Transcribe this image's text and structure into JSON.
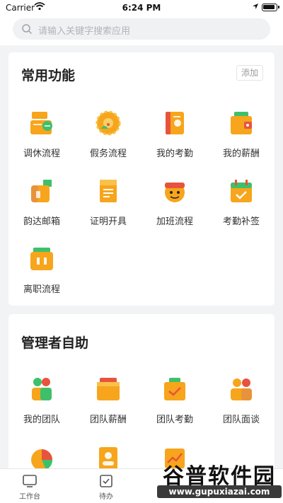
{
  "status": {
    "carrier": "Carrier",
    "time": "6:24 PM"
  },
  "search": {
    "placeholder": "请输入关键字搜索应用"
  },
  "common": {
    "title": "常用功能",
    "add_label": "添加",
    "items": [
      {
        "label": "调休流程",
        "icon": "leave-swap-icon"
      },
      {
        "label": "假务流程",
        "icon": "vacation-icon"
      },
      {
        "label": "我的考勤",
        "icon": "attendance-icon"
      },
      {
        "label": "我的薪酬",
        "icon": "salary-icon"
      },
      {
        "label": "韵达邮箱",
        "icon": "mailbox-icon"
      },
      {
        "label": "证明开具",
        "icon": "certificate-icon"
      },
      {
        "label": "加班流程",
        "icon": "overtime-icon"
      },
      {
        "label": "考勤补签",
        "icon": "attendance-resign-icon"
      },
      {
        "label": "离职流程",
        "icon": "resignation-icon"
      }
    ]
  },
  "admin": {
    "title": "管理者自助",
    "items": [
      {
        "label": "我的团队",
        "icon": "my-team-icon"
      },
      {
        "label": "团队薪酬",
        "icon": "team-salary-icon"
      },
      {
        "label": "团队考勤",
        "icon": "team-attendance-icon"
      },
      {
        "label": "团队面谈",
        "icon": "team-interview-icon"
      }
    ]
  },
  "tabs": [
    {
      "label": "工作台",
      "icon": "workbench-icon"
    },
    {
      "label": "待办",
      "icon": "todo-icon"
    }
  ],
  "watermark": {
    "top": "谷普软件园",
    "bottom": "www.gupuxiazai.com"
  },
  "colors": {
    "accent_orange": "#f7a51c",
    "accent_green": "#3ec06b",
    "accent_red": "#e8533d"
  }
}
